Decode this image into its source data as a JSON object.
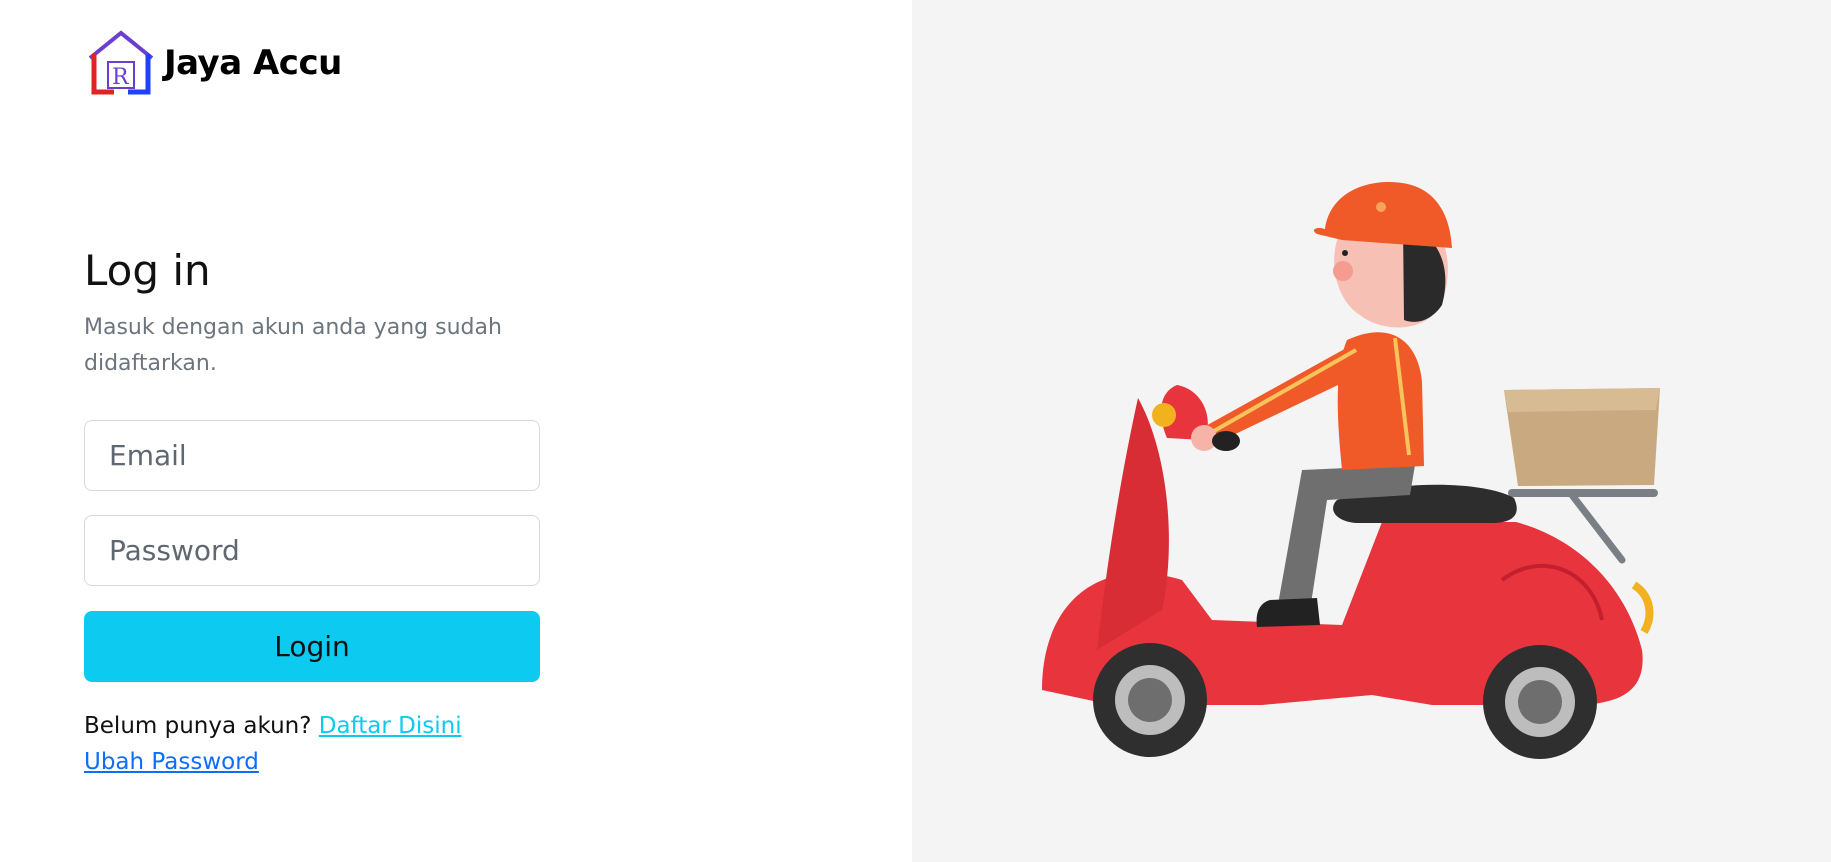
{
  "brand": {
    "logo_text": "R",
    "name": "Jaya Accu"
  },
  "login": {
    "title": "Log in",
    "subtitle": "Masuk dengan akun anda yang sudah didaftarkan.",
    "email_placeholder": "Email",
    "password_placeholder": "Password",
    "button_label": "Login",
    "register_prompt": "Belum punya akun?",
    "register_link": "Daftar Disini",
    "change_password_link": "Ubah Password"
  },
  "colors": {
    "primary_button": "#0dcaf0",
    "register_link": "#0dcaf0",
    "change_password_link": "#0d6efd",
    "right_background": "#f4f4f4",
    "scooter": "#e8343c",
    "shirt": "#f05a28",
    "box": "#c9a97f"
  },
  "illustration": {
    "subject": "delivery-rider-on-scooter"
  }
}
